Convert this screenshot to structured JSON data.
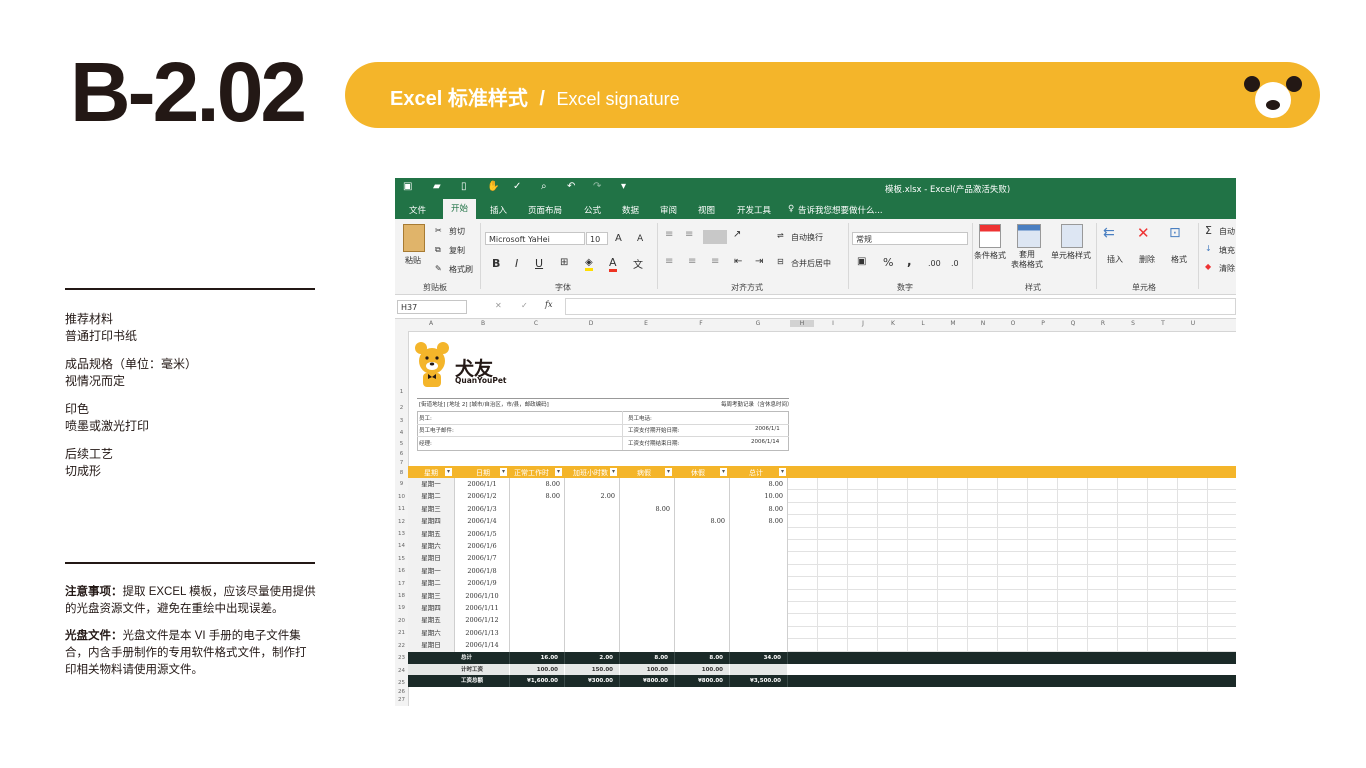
{
  "page": {
    "code": "B-2.02",
    "title_cn": "Excel 标准样式",
    "separator": "/",
    "title_en": "Excel signature"
  },
  "specs": [
    {
      "label": "推荐材料",
      "value": "普通打印书纸"
    },
    {
      "label": "成品规格（单位：毫米）",
      "value": "视情况而定"
    },
    {
      "label": "印色",
      "value": "喷墨或激光打印"
    },
    {
      "label": "后续工艺",
      "value": "切成形"
    }
  ],
  "notes": [
    {
      "label": "注意事项：",
      "text": "提取 EXCEL 模板，应该尽量使用提供的光盘资源文件，避免在重绘中出现误差。"
    },
    {
      "label": "光盘文件：",
      "text": "光盘文件是本 VI 手册的电子文件集合，内含手册制作的专用软件格式文件，制作打印相关物料请使用源文件。"
    }
  ],
  "colors": {
    "brand_yellow": "#f4b52a",
    "excel_green": "#217346",
    "dark_row": "#1b2a28"
  },
  "excel": {
    "window_title": "模板.xlsx - Excel(产品激活失败)",
    "tabs": [
      "文件",
      "开始",
      "插入",
      "页面布局",
      "公式",
      "数据",
      "审阅",
      "视图",
      "开发工具"
    ],
    "active_tab": "开始",
    "tell_me": "告诉我您想要做什么...",
    "ribbon": {
      "clipboard": {
        "paste": "粘贴",
        "cut": "剪切",
        "copy": "复制",
        "format_painter": "格式刷",
        "label": "剪贴板"
      },
      "font": {
        "name": "Microsoft YaHei",
        "size": "10",
        "bold": "B",
        "italic": "I",
        "underline": "U",
        "label": "字体",
        "grow": "A",
        "shrink": "A",
        "color_a": "A",
        "wen": "文"
      },
      "alignment": {
        "wrap": "自动换行",
        "merge": "合并后居中",
        "label": "对齐方式"
      },
      "number": {
        "format": "常规",
        "percent": "%",
        "comma": ",",
        "inc": ".00",
        "dec": ".0",
        "label": "数字"
      },
      "styles": {
        "conditional": "条件格式",
        "table": "套用\n表格格式",
        "cell_styles": "单元格样式",
        "label": "样式"
      },
      "cells": {
        "insert": "插入",
        "delete": "删除",
        "format": "格式",
        "label": "单元格"
      },
      "editing": {
        "autosum": "自动",
        "fill": "填充",
        "clear": "清除"
      }
    },
    "name_box": "H37",
    "fx": "fx",
    "columns": [
      "A",
      "B",
      "C",
      "D",
      "E",
      "F",
      "G",
      "H",
      "I",
      "J",
      "K",
      "L",
      "M",
      "N",
      "O",
      "P",
      "Q",
      "R",
      "S",
      "T",
      "U"
    ],
    "rows": [
      "1",
      "2",
      "3",
      "4",
      "5",
      "6",
      "7",
      "8",
      "9",
      "10",
      "11",
      "12",
      "13",
      "14",
      "15",
      "16",
      "17",
      "18",
      "19",
      "20",
      "21",
      "22",
      "23",
      "24",
      "25",
      "26",
      "27"
    ],
    "logo": {
      "cn": "犬友",
      "en": "QuanYouPet"
    },
    "info": {
      "address": "[街道地址] [地址 2] [城市/自治区，市/县，邮政编码]",
      "right_title": "每周考勤记录（含休息时间）",
      "employee": "员工:",
      "phone": "员工电话:",
      "email": "员工电子邮件:",
      "manager": "经理:",
      "start_label": "工资支付期开始日期:",
      "start_value": "2006/1/1",
      "end_label": "工资支付期结束日期:",
      "end_value": "2006/1/14"
    },
    "table_headers": [
      "星期",
      "日期",
      "正常工作时",
      "加班小时数",
      "病假",
      "休假",
      "总计"
    ],
    "rows_data": [
      {
        "day": "星期一",
        "date": "2006/1/1",
        "normal": "8.00",
        "ot": "",
        "sick": "",
        "vac": "",
        "total": "8.00"
      },
      {
        "day": "星期二",
        "date": "2006/1/2",
        "normal": "8.00",
        "ot": "2.00",
        "sick": "",
        "vac": "",
        "total": "10.00"
      },
      {
        "day": "星期三",
        "date": "2006/1/3",
        "normal": "",
        "ot": "",
        "sick": "8.00",
        "vac": "",
        "total": "8.00"
      },
      {
        "day": "星期四",
        "date": "2006/1/4",
        "normal": "",
        "ot": "",
        "sick": "",
        "vac": "8.00",
        "total": "8.00"
      },
      {
        "day": "星期五",
        "date": "2006/1/5",
        "normal": "",
        "ot": "",
        "sick": "",
        "vac": "",
        "total": ""
      },
      {
        "day": "星期六",
        "date": "2006/1/6",
        "normal": "",
        "ot": "",
        "sick": "",
        "vac": "",
        "total": ""
      },
      {
        "day": "星期日",
        "date": "2006/1/7",
        "normal": "",
        "ot": "",
        "sick": "",
        "vac": "",
        "total": ""
      },
      {
        "day": "星期一",
        "date": "2006/1/8",
        "normal": "",
        "ot": "",
        "sick": "",
        "vac": "",
        "total": ""
      },
      {
        "day": "星期二",
        "date": "2006/1/9",
        "normal": "",
        "ot": "",
        "sick": "",
        "vac": "",
        "total": ""
      },
      {
        "day": "星期三",
        "date": "2006/1/10",
        "normal": "",
        "ot": "",
        "sick": "",
        "vac": "",
        "total": ""
      },
      {
        "day": "星期四",
        "date": "2006/1/11",
        "normal": "",
        "ot": "",
        "sick": "",
        "vac": "",
        "total": ""
      },
      {
        "day": "星期五",
        "date": "2006/1/12",
        "normal": "",
        "ot": "",
        "sick": "",
        "vac": "",
        "total": ""
      },
      {
        "day": "星期六",
        "date": "2006/1/13",
        "normal": "",
        "ot": "",
        "sick": "",
        "vac": "",
        "total": ""
      },
      {
        "day": "星期日",
        "date": "2006/1/14",
        "normal": "",
        "ot": "",
        "sick": "",
        "vac": "",
        "total": ""
      }
    ],
    "summary": [
      {
        "label": "总计",
        "normal": "16.00",
        "ot": "2.00",
        "sick": "8.00",
        "vac": "8.00",
        "total": "34.00"
      },
      {
        "label": "计时工资",
        "normal": "100.00",
        "ot": "150.00",
        "sick": "100.00",
        "vac": "100.00",
        "total": ""
      },
      {
        "label": "工资总额",
        "normal": "¥1,600.00",
        "ot": "¥300.00",
        "sick": "¥800.00",
        "vac": "¥800.00",
        "total": "¥3,500.00"
      }
    ]
  }
}
